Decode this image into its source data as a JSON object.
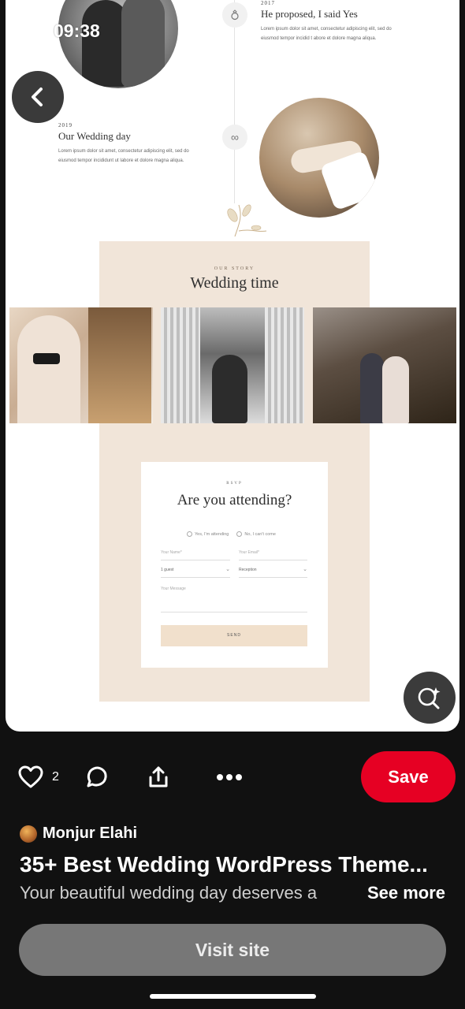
{
  "status_bar": {
    "time": "09:38"
  },
  "timeline": {
    "item1": {
      "year": "2017",
      "title": "He proposed, I said Yes",
      "body": "Lorem ipsum dolor sit amet, consectetur adipiscing elit, sed do eiusmod tempor incidid t abore et dolore magna aliqua."
    },
    "item2": {
      "year": "2019",
      "title": "Our Wedding day",
      "body": "Lorem ipsum dolor sit amet, consectetur adipiscing elit, sed do eiusmod tempor incididunt ut labore et dolore magna aliqua."
    },
    "icons": [
      "ring-icon",
      "infinity-icon"
    ]
  },
  "story": {
    "kicker": "OUR STORY",
    "heading": "Wedding time"
  },
  "rsvp": {
    "kicker": "RSVP",
    "heading": "Are you attending?",
    "option_yes": "Yes, I'm attending",
    "option_no": "No, I can't come",
    "name_placeholder": "Your Name*",
    "email_placeholder": "Your Email*",
    "guests_value": "1 guest",
    "event_value": "Reception",
    "message_placeholder": "Your Message",
    "send_label": "SEND"
  },
  "actions": {
    "like_count": "2",
    "save_label": "Save"
  },
  "pin": {
    "author": "Monjur Elahi",
    "title": "35+ Best Wedding WordPress Theme...",
    "description": "Your beautiful wedding day deserves a",
    "see_more": "See more",
    "visit_label": "Visit site"
  },
  "colors": {
    "save_red": "#e60023",
    "beige": "#f1e5d9",
    "background": "#111111"
  }
}
